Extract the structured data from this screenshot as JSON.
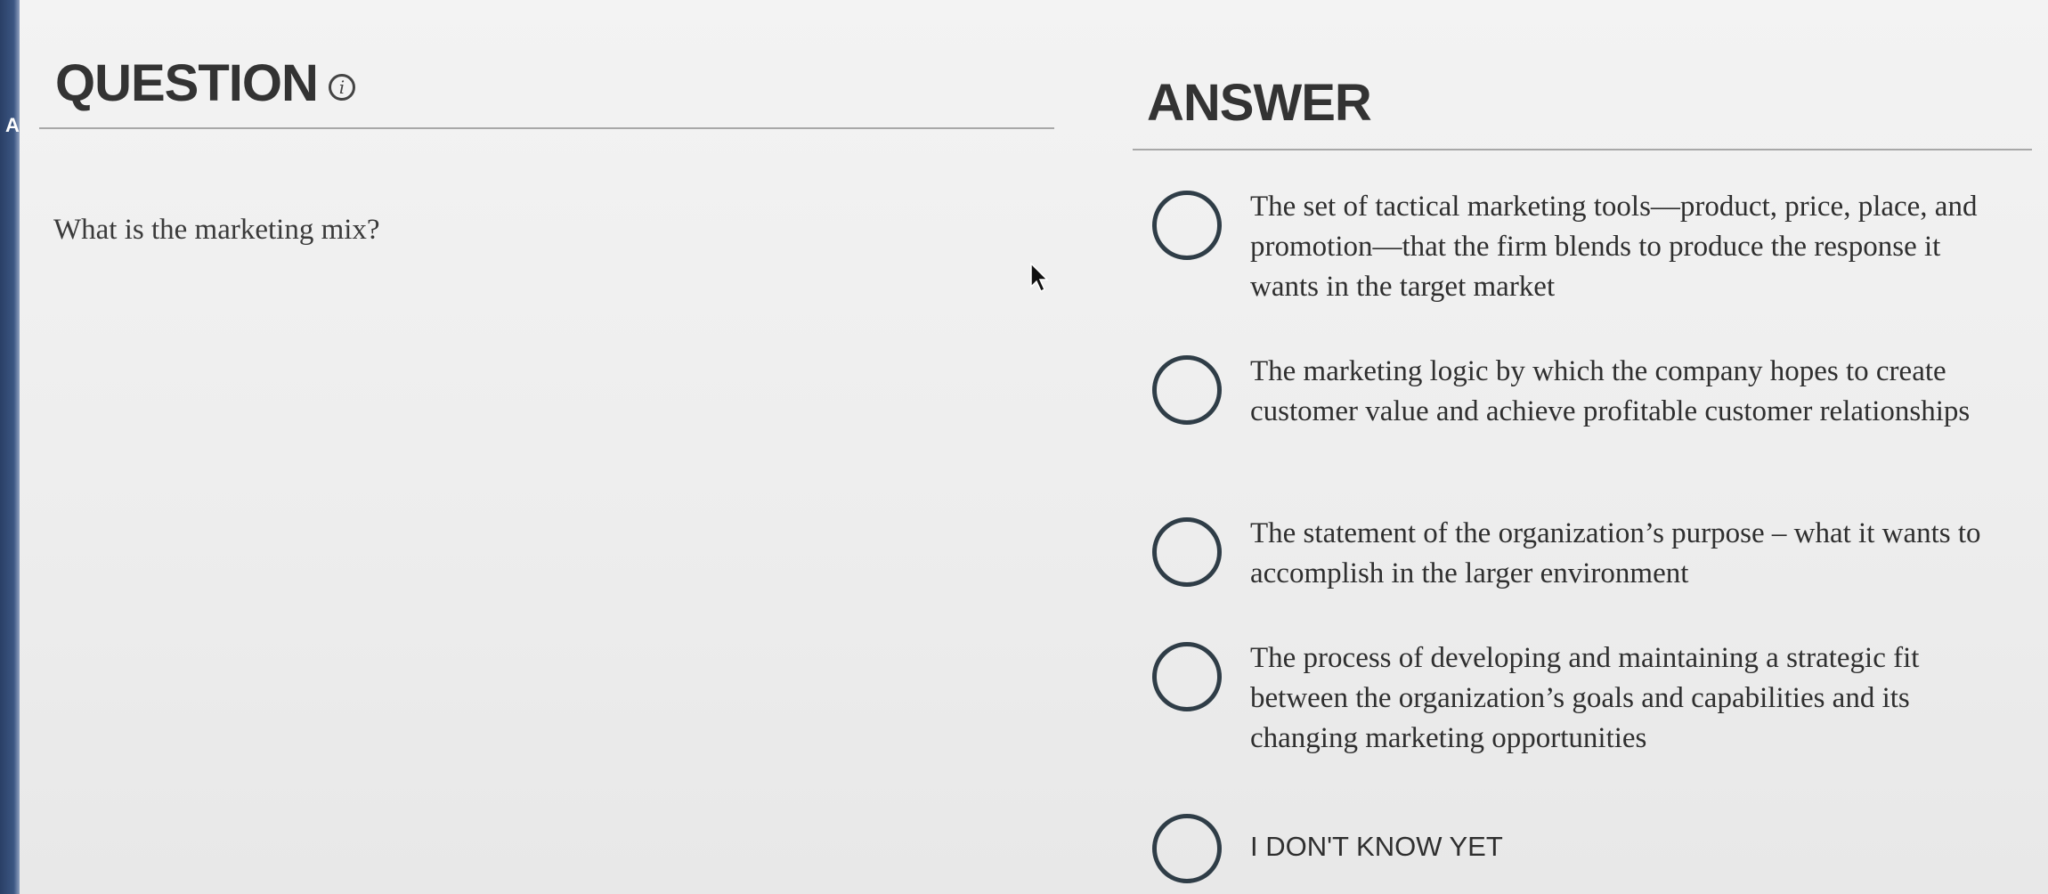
{
  "edge_letter": "A",
  "question": {
    "heading": "QUESTION",
    "info_icon": "info-icon",
    "text": "What is the marketing mix?"
  },
  "answer": {
    "heading": "ANSWER",
    "options": [
      {
        "label": "The set of tactical marketing tools—product, price, place, and promotion—that the firm blends to produce the response it wants in the target market"
      },
      {
        "label": "The marketing logic by which the company hopes to create customer value and achieve profitable customer relationships"
      },
      {
        "label": "The statement of the organization’s purpose – what it wants to accomplish in the larger environment"
      },
      {
        "label": "The process of developing and maintaining a strategic fit between the organization’s goals and capabilities and its changing marketing opportunities"
      },
      {
        "label": "I DON'T KNOW YET"
      }
    ]
  }
}
